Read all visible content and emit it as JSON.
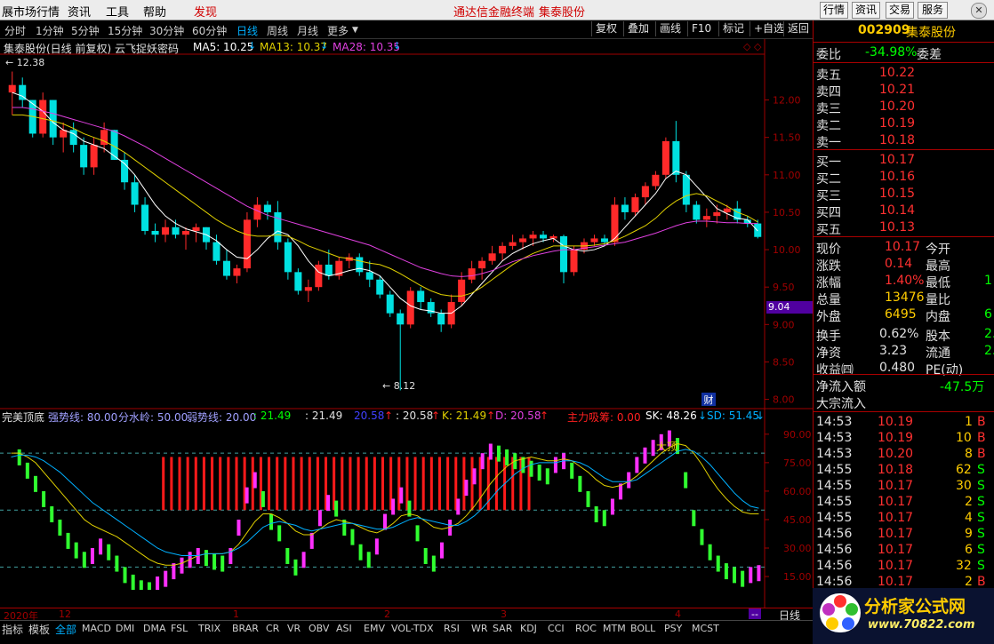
{
  "menubar": {
    "items": [
      "展市场行情",
      "资讯",
      "工具",
      "帮助"
    ],
    "discover": "发现",
    "center_links": [
      "通达信金融终端",
      "集泰股份"
    ],
    "right_buttons": [
      "行情",
      "资讯",
      "交易",
      "服务"
    ]
  },
  "periods": {
    "items": [
      "分时",
      "1分钟",
      "5分钟",
      "15分钟",
      "30分钟",
      "60分钟",
      "日线",
      "周线",
      "月线",
      "更多"
    ],
    "active_index": 6,
    "drop_icon": "triangle-down-icon"
  },
  "toolbar": [
    "复权",
    "叠加",
    "画线",
    "F10",
    "标记",
    "+自选",
    "返回"
  ],
  "main_chart": {
    "title": "集泰股份(日线 前复权) 云飞捉妖密码",
    "ma5": "MA5: 10.25",
    "ma13": "MA13: 10.37",
    "ma28": "MA28: 10.35",
    "high_label": "12.38",
    "low_label": "8.12",
    "cursor_price": "9.04",
    "cai_badge": "财",
    "y_ticks": [
      "12.00",
      "11.50",
      "11.00",
      "10.50",
      "10.00",
      "9.50",
      "9.00",
      "8.50",
      "8.00"
    ],
    "colors": {
      "up": "#ff2a2a",
      "down": "#00e0e0",
      "ma5": "#ffffff",
      "ma13": "#e0d000",
      "ma28": "#e040e0"
    }
  },
  "chart_data": {
    "type": "candlestick",
    "ylim": [
      7.9,
      12.6
    ],
    "ohlc": [
      [
        12.1,
        12.38,
        11.8,
        12.2
      ],
      [
        12.2,
        12.3,
        11.9,
        12.0
      ],
      [
        12.0,
        12.0,
        11.5,
        11.55
      ],
      [
        11.55,
        12.1,
        11.5,
        12.0
      ],
      [
        12.0,
        12.0,
        11.4,
        11.5
      ],
      [
        11.5,
        11.7,
        11.3,
        11.6
      ],
      [
        11.6,
        11.7,
        11.3,
        11.4
      ],
      [
        11.4,
        11.5,
        11.0,
        11.1
      ],
      [
        11.1,
        11.5,
        11.0,
        11.4
      ],
      [
        11.4,
        11.7,
        11.3,
        11.6
      ],
      [
        11.6,
        11.6,
        11.2,
        11.2
      ],
      [
        11.2,
        11.3,
        10.8,
        10.9
      ],
      [
        10.9,
        11.0,
        10.5,
        10.6
      ],
      [
        10.6,
        10.7,
        10.2,
        10.25
      ],
      [
        10.25,
        10.35,
        10.1,
        10.2
      ],
      [
        10.2,
        10.4,
        10.1,
        10.3
      ],
      [
        10.3,
        10.4,
        10.15,
        10.2
      ],
      [
        10.2,
        10.3,
        10.0,
        10.25
      ],
      [
        10.25,
        10.35,
        10.1,
        10.3
      ],
      [
        10.3,
        10.3,
        10.0,
        10.1
      ],
      [
        10.1,
        10.2,
        9.8,
        9.85
      ],
      [
        9.85,
        10.0,
        9.6,
        9.65
      ],
      [
        9.65,
        9.8,
        9.55,
        9.75
      ],
      [
        9.75,
        10.5,
        9.7,
        10.4
      ],
      [
        10.4,
        10.7,
        10.3,
        10.6
      ],
      [
        10.6,
        10.65,
        10.4,
        10.5
      ],
      [
        10.5,
        10.65,
        10.0,
        10.1
      ],
      [
        10.1,
        10.15,
        9.6,
        9.7
      ],
      [
        9.7,
        9.75,
        9.4,
        9.45
      ],
      [
        9.45,
        9.6,
        9.3,
        9.5
      ],
      [
        9.5,
        9.85,
        9.45,
        9.8
      ],
      [
        9.8,
        10.0,
        9.6,
        9.65
      ],
      [
        9.65,
        9.9,
        9.6,
        9.85
      ],
      [
        9.85,
        9.95,
        9.75,
        9.9
      ],
      [
        9.9,
        9.95,
        9.65,
        9.7
      ],
      [
        9.7,
        9.85,
        9.5,
        9.6
      ],
      [
        9.6,
        9.65,
        9.35,
        9.4
      ],
      [
        9.4,
        9.45,
        9.1,
        9.15
      ],
      [
        9.15,
        9.2,
        8.12,
        9.0
      ],
      [
        9.0,
        9.5,
        8.95,
        9.45
      ],
      [
        9.45,
        9.5,
        9.2,
        9.3
      ],
      [
        9.3,
        9.35,
        9.1,
        9.15
      ],
      [
        9.15,
        9.2,
        8.9,
        9.0
      ],
      [
        9.0,
        9.4,
        8.95,
        9.3
      ],
      [
        9.3,
        9.7,
        9.25,
        9.6
      ],
      [
        9.6,
        9.85,
        9.55,
        9.75
      ],
      [
        9.75,
        9.9,
        9.6,
        9.85
      ],
      [
        9.85,
        10.05,
        9.8,
        9.95
      ],
      [
        9.95,
        10.1,
        9.85,
        10.05
      ],
      [
        10.05,
        10.2,
        10.0,
        10.1
      ],
      [
        10.1,
        10.2,
        10.0,
        10.15
      ],
      [
        10.15,
        10.25,
        10.05,
        10.2
      ],
      [
        10.2,
        10.25,
        10.1,
        10.15
      ],
      [
        10.15,
        10.2,
        10.1,
        10.18
      ],
      [
        10.18,
        10.2,
        9.55,
        9.7
      ],
      [
        9.7,
        10.05,
        9.65,
        10.0
      ],
      [
        10.0,
        10.15,
        9.95,
        10.1
      ],
      [
        10.1,
        10.2,
        10.05,
        10.15
      ],
      [
        10.15,
        10.2,
        10.05,
        10.1
      ],
      [
        10.1,
        10.7,
        10.05,
        10.6
      ],
      [
        10.6,
        10.7,
        10.4,
        10.5
      ],
      [
        10.5,
        10.75,
        10.45,
        10.7
      ],
      [
        10.7,
        10.9,
        10.6,
        10.85
      ],
      [
        10.85,
        11.05,
        10.8,
        11.0
      ],
      [
        11.0,
        11.5,
        10.95,
        11.45
      ],
      [
        11.45,
        11.72,
        10.9,
        11.0
      ],
      [
        11.0,
        11.05,
        10.5,
        10.6
      ],
      [
        10.6,
        10.65,
        10.35,
        10.4
      ],
      [
        10.4,
        10.55,
        10.3,
        10.45
      ],
      [
        10.45,
        10.6,
        10.35,
        10.5
      ],
      [
        10.5,
        10.6,
        10.4,
        10.55
      ],
      [
        10.55,
        10.65,
        10.35,
        10.4
      ],
      [
        10.4,
        10.45,
        10.3,
        10.35
      ],
      [
        10.35,
        10.4,
        10.15,
        10.17
      ]
    ],
    "ma5": [
      12.1,
      12.05,
      11.95,
      11.85,
      11.7,
      11.6,
      11.55,
      11.45,
      11.4,
      11.35,
      11.25,
      11.15,
      11.0,
      10.8,
      10.6,
      10.45,
      10.35,
      10.28,
      10.24,
      10.2,
      10.12,
      10.0,
      9.9,
      9.88,
      10.0,
      10.15,
      10.25,
      10.2,
      10.05,
      9.85,
      9.7,
      9.65,
      9.68,
      9.72,
      9.75,
      9.72,
      9.65,
      9.5,
      9.35,
      9.25,
      9.2,
      9.18,
      9.15,
      9.15,
      9.25,
      9.4,
      9.55,
      9.7,
      9.85,
      9.95,
      10.02,
      10.08,
      10.12,
      10.15,
      10.05,
      10.0,
      9.98,
      10.0,
      10.05,
      10.15,
      10.3,
      10.45,
      10.6,
      10.75,
      10.95,
      11.05,
      11.0,
      10.85,
      10.7,
      10.55,
      10.48,
      10.42,
      10.4,
      10.25
    ],
    "ma13": [
      11.8,
      11.8,
      11.78,
      11.75,
      11.72,
      11.68,
      11.62,
      11.55,
      11.5,
      11.45,
      11.38,
      11.3,
      11.2,
      11.1,
      11.0,
      10.9,
      10.8,
      10.7,
      10.6,
      10.5,
      10.4,
      10.32,
      10.25,
      10.2,
      10.18,
      10.18,
      10.2,
      10.18,
      10.12,
      10.05,
      10.0,
      9.95,
      9.9,
      9.88,
      9.85,
      9.82,
      9.8,
      9.75,
      9.68,
      9.6,
      9.52,
      9.45,
      9.4,
      9.38,
      9.38,
      9.42,
      9.5,
      9.6,
      9.7,
      9.8,
      9.88,
      9.95,
      10.0,
      10.05,
      10.05,
      10.05,
      10.05,
      10.06,
      10.08,
      10.12,
      10.18,
      10.25,
      10.32,
      10.42,
      10.55,
      10.65,
      10.72,
      10.75,
      10.72,
      10.65,
      10.58,
      10.5,
      10.45,
      10.37
    ],
    "ma28": [
      11.9,
      11.9,
      11.88,
      11.85,
      11.82,
      11.78,
      11.74,
      11.7,
      11.66,
      11.62,
      11.58,
      11.52,
      11.45,
      11.38,
      11.3,
      11.22,
      11.14,
      11.06,
      10.98,
      10.9,
      10.82,
      10.74,
      10.66,
      10.58,
      10.52,
      10.46,
      10.42,
      10.38,
      10.34,
      10.3,
      10.26,
      10.22,
      10.18,
      10.14,
      10.1,
      10.06,
      10.0,
      9.94,
      9.88,
      9.82,
      9.76,
      9.72,
      9.68,
      9.65,
      9.64,
      9.65,
      9.68,
      9.72,
      9.78,
      9.84,
      9.88,
      9.92,
      9.95,
      9.98,
      10.0,
      10.0,
      10.02,
      10.04,
      10.06,
      10.08,
      10.1,
      10.14,
      10.18,
      10.22,
      10.27,
      10.32,
      10.36,
      10.38,
      10.38,
      10.37,
      10.36,
      10.36,
      10.35,
      10.35
    ]
  },
  "indicator": {
    "name": "完美顶底",
    "strong": "强势线: 80.00",
    "divide": "分水岭: 50.00",
    "weak": "弱势线: 20.00",
    "v1": ": 21.49",
    "v2": ": 21.49",
    "v3": "20.58",
    "v4": ": 20.58",
    "k": "K: 21.49",
    "d": "D: 20.58",
    "main_absorb": "主力吸筹: 0.00",
    "sk": "SK: 48.26",
    "sd": "SD: 51.45",
    "top_label": "大顶",
    "y_ticks": [
      "90.00",
      "75.00",
      "60.00",
      "45.00",
      "30.00",
      "15.00"
    ],
    "k_line": [
      85,
      82,
      75,
      68,
      60,
      52,
      45,
      38,
      33,
      28,
      30,
      35,
      32,
      26,
      20,
      16,
      13,
      12,
      15,
      18,
      22,
      25,
      28,
      30,
      29,
      27,
      26,
      30,
      45,
      62,
      70,
      60,
      48,
      42,
      30,
      24,
      28,
      38,
      50,
      58,
      55,
      45,
      40,
      32,
      28,
      35,
      48,
      56,
      62,
      55,
      42,
      30,
      26,
      33,
      45,
      56,
      66,
      72,
      80,
      85,
      84,
      82,
      80,
      78,
      76,
      74,
      72,
      78,
      80,
      75,
      68,
      60,
      52,
      50,
      56,
      64,
      70,
      78,
      83,
      87,
      90,
      92,
      88,
      70,
      50,
      40,
      32,
      26,
      22,
      20,
      18,
      20,
      21
    ],
    "sk_line": [
      80,
      80,
      78,
      75,
      70,
      65,
      60,
      55,
      50,
      45,
      42,
      40,
      38,
      36,
      33,
      30,
      27,
      24,
      22,
      21,
      21,
      22,
      24,
      26,
      27,
      27,
      27,
      28,
      32,
      38,
      44,
      48,
      48,
      46,
      43,
      39,
      37,
      37,
      40,
      43,
      45,
      44,
      43,
      41,
      39,
      38,
      40,
      43,
      47,
      48,
      47,
      44,
      41,
      40,
      41,
      43,
      47,
      52,
      58,
      64,
      69,
      73,
      76,
      77,
      78,
      77,
      76,
      76,
      77,
      76,
      73,
      70,
      66,
      63,
      62,
      63,
      65,
      68,
      72,
      76,
      80,
      83,
      85,
      84,
      80,
      74,
      67,
      61,
      56,
      52,
      49,
      48,
      48
    ],
    "sd_line": [
      78,
      79,
      79,
      78,
      76,
      73,
      70,
      66,
      62,
      58,
      54,
      51,
      48,
      45,
      42,
      39,
      36,
      33,
      30,
      28,
      27,
      26,
      26,
      26,
      27,
      27,
      27,
      28,
      30,
      33,
      37,
      41,
      43,
      44,
      43,
      42,
      40,
      39,
      40,
      41,
      42,
      43,
      43,
      42,
      41,
      40,
      40,
      41,
      43,
      45,
      46,
      45,
      44,
      43,
      42,
      42,
      44,
      47,
      51,
      56,
      61,
      65,
      69,
      72,
      74,
      75,
      75,
      75,
      76,
      76,
      75,
      73,
      70,
      67,
      65,
      65,
      65,
      66,
      69,
      72,
      75,
      78,
      81,
      82,
      81,
      78,
      74,
      69,
      64,
      59,
      55,
      52,
      51
    ],
    "absorb_zone_from": 19,
    "absorb_zone_to": 85
  },
  "date_axis": {
    "labels": [
      "2020年",
      "12",
      "1",
      "2",
      "3",
      "4"
    ],
    "right_label": "日线"
  },
  "right_panel": {
    "code": "002909",
    "name": "集泰股份",
    "webi_label": "委比",
    "webi_val": "-34.98%",
    "weicha_label": "委差",
    "asks": [
      [
        "卖五",
        "10.22"
      ],
      [
        "卖四",
        "10.21"
      ],
      [
        "卖三",
        "10.20"
      ],
      [
        "卖二",
        "10.19"
      ],
      [
        "卖一",
        "10.18"
      ]
    ],
    "bids": [
      [
        "买一",
        "10.17"
      ],
      [
        "买二",
        "10.16"
      ],
      [
        "买三",
        "10.15"
      ],
      [
        "买四",
        "10.14"
      ],
      [
        "买五",
        "10.13"
      ]
    ],
    "stats": [
      [
        "现价",
        "10.17",
        "今开",
        ""
      ],
      [
        "涨跌",
        "0.14",
        "最高",
        ""
      ],
      [
        "涨幅",
        "1.40%",
        "最低",
        "1"
      ],
      [
        "总量",
        "13476",
        "量比",
        ""
      ],
      [
        "外盘",
        "6495",
        "内盘",
        "6"
      ],
      [
        "换手",
        "0.62%",
        "股本",
        "2."
      ],
      [
        "净资",
        "3.23",
        "流通",
        "2."
      ],
      [
        "收益㈣",
        "0.480",
        "PE(动)",
        ""
      ]
    ],
    "net_inflow_label": "净流入额",
    "net_inflow": "-47.5万",
    "big_inflow_label": "大宗流入",
    "ticks": [
      [
        "14:53",
        "10.19",
        "1",
        "B"
      ],
      [
        "14:53",
        "10.19",
        "10",
        "B"
      ],
      [
        "14:53",
        "10.20",
        "8",
        "B"
      ],
      [
        "14:55",
        "10.18",
        "62",
        "S"
      ],
      [
        "14:55",
        "10.17",
        "30",
        "S"
      ],
      [
        "14:55",
        "10.17",
        "2",
        "S"
      ],
      [
        "14:55",
        "10.17",
        "4",
        "S"
      ],
      [
        "14:56",
        "10.17",
        "9",
        "S"
      ],
      [
        "14:56",
        "10.17",
        "6",
        "S"
      ],
      [
        "14:56",
        "10.17",
        "32",
        "S"
      ],
      [
        "14:56",
        "10.17",
        "2",
        "B"
      ]
    ]
  },
  "tabs": [
    "指标",
    "模板",
    "全部",
    "MACD",
    "DMI",
    "DMA",
    "FSL",
    "TRIX",
    "BRAR",
    "CR",
    "VR",
    "OBV",
    "ASI",
    "EMV",
    "VOL-TDX",
    "RSI",
    "WR",
    "SAR",
    "KDJ",
    "CCI",
    "ROC",
    "MTM",
    "BOLL",
    "PSY",
    "MCST"
  ],
  "watermark": {
    "text": "分析家公式网",
    "url": "www.70822.com"
  }
}
